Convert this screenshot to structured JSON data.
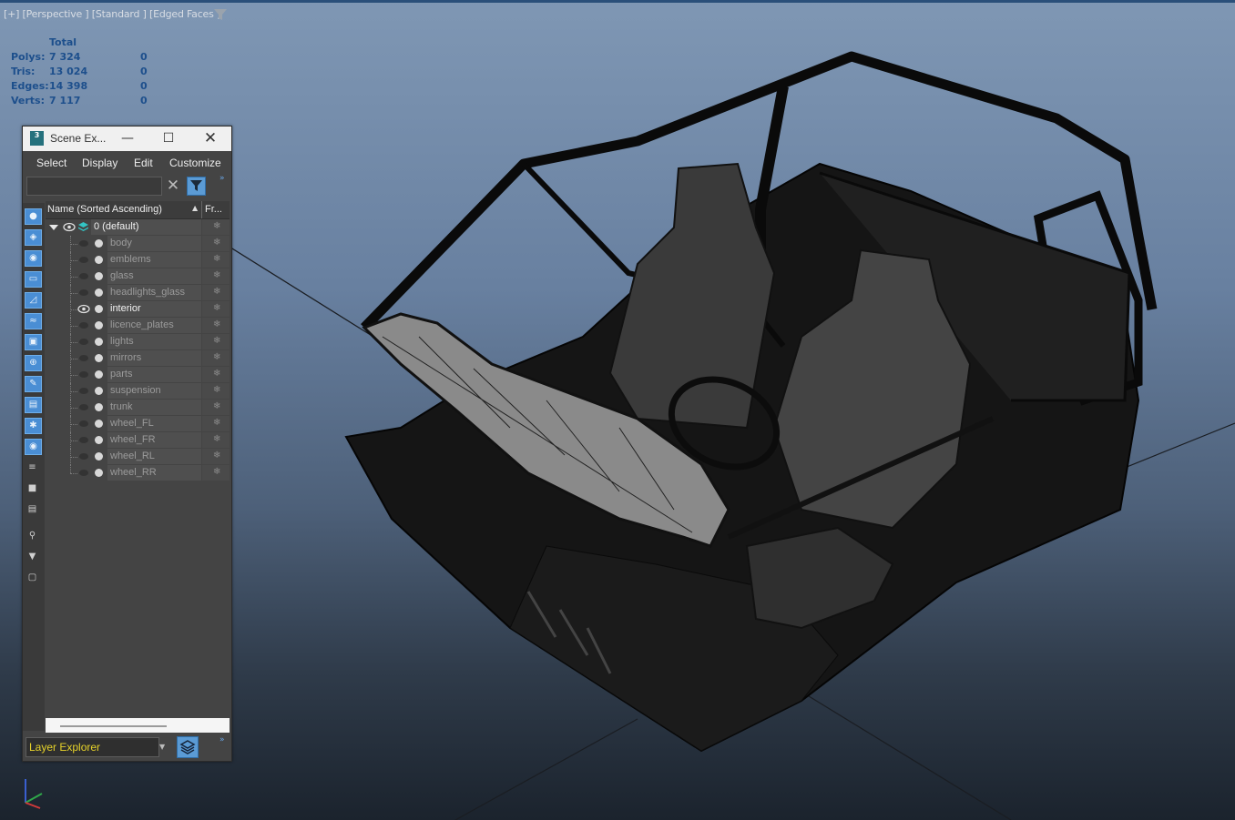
{
  "viewport": {
    "label": "[+] [Perspective ] [Standard ] [Edged Faces ]",
    "stats": {
      "header": "Total",
      "rows": [
        {
          "label": "Polys:",
          "total": "7 324",
          "selected": "0"
        },
        {
          "label": "Tris:",
          "total": "13 024",
          "selected": "0"
        },
        {
          "label": "Edges:",
          "total": "14 398",
          "selected": "0"
        },
        {
          "label": "Verts:",
          "total": "7 117",
          "selected": "0"
        }
      ]
    }
  },
  "explorer": {
    "title": "Scene Ex...",
    "app_icon_text": "3",
    "menu": [
      "Select",
      "Display",
      "Edit",
      "Customize"
    ],
    "search": {
      "value": "",
      "placeholder": ""
    },
    "columns": {
      "name": "Name (Sorted Ascending)",
      "freeze": "Fr..."
    },
    "root_layer": "0 (default)",
    "layers": [
      {
        "name": "body",
        "visible": false,
        "active": false
      },
      {
        "name": "emblems",
        "visible": false,
        "active": false
      },
      {
        "name": "glass",
        "visible": false,
        "active": false
      },
      {
        "name": "headlights_glass",
        "visible": false,
        "active": false
      },
      {
        "name": "interior",
        "visible": true,
        "active": true
      },
      {
        "name": "licence_plates",
        "visible": false,
        "active": false
      },
      {
        "name": "lights",
        "visible": false,
        "active": false
      },
      {
        "name": "mirrors",
        "visible": false,
        "active": false
      },
      {
        "name": "parts",
        "visible": false,
        "active": false
      },
      {
        "name": "suspension",
        "visible": false,
        "active": false
      },
      {
        "name": "trunk",
        "visible": false,
        "active": false
      },
      {
        "name": "wheel_FL",
        "visible": false,
        "active": false
      },
      {
        "name": "wheel_FR",
        "visible": false,
        "active": false
      },
      {
        "name": "wheel_RL",
        "visible": false,
        "active": false
      },
      {
        "name": "wheel_RR",
        "visible": false,
        "active": false
      }
    ],
    "explorer_mode": "Layer Explorer",
    "toolbar_icons": [
      "geometry-filter-icon",
      "shapes-filter-icon",
      "lights-filter-icon",
      "cameras-filter-icon",
      "helpers-filter-icon",
      "spacewarps-filter-icon",
      "groups-filter-icon",
      "xrefs-filter-icon",
      "bones-filter-icon",
      "containers-filter-icon",
      "frozen-filter-icon",
      "hidden-filter-icon",
      "display-all-icon",
      "display-none-icon",
      "invert-display-icon",
      "filter-settings-icon",
      "filter-icon",
      "selection-sets-icon"
    ]
  },
  "colors": {
    "accent": "#5b9bd5",
    "stats_text": "#1d4f8c",
    "dropdown_text": "#e6d22a"
  }
}
